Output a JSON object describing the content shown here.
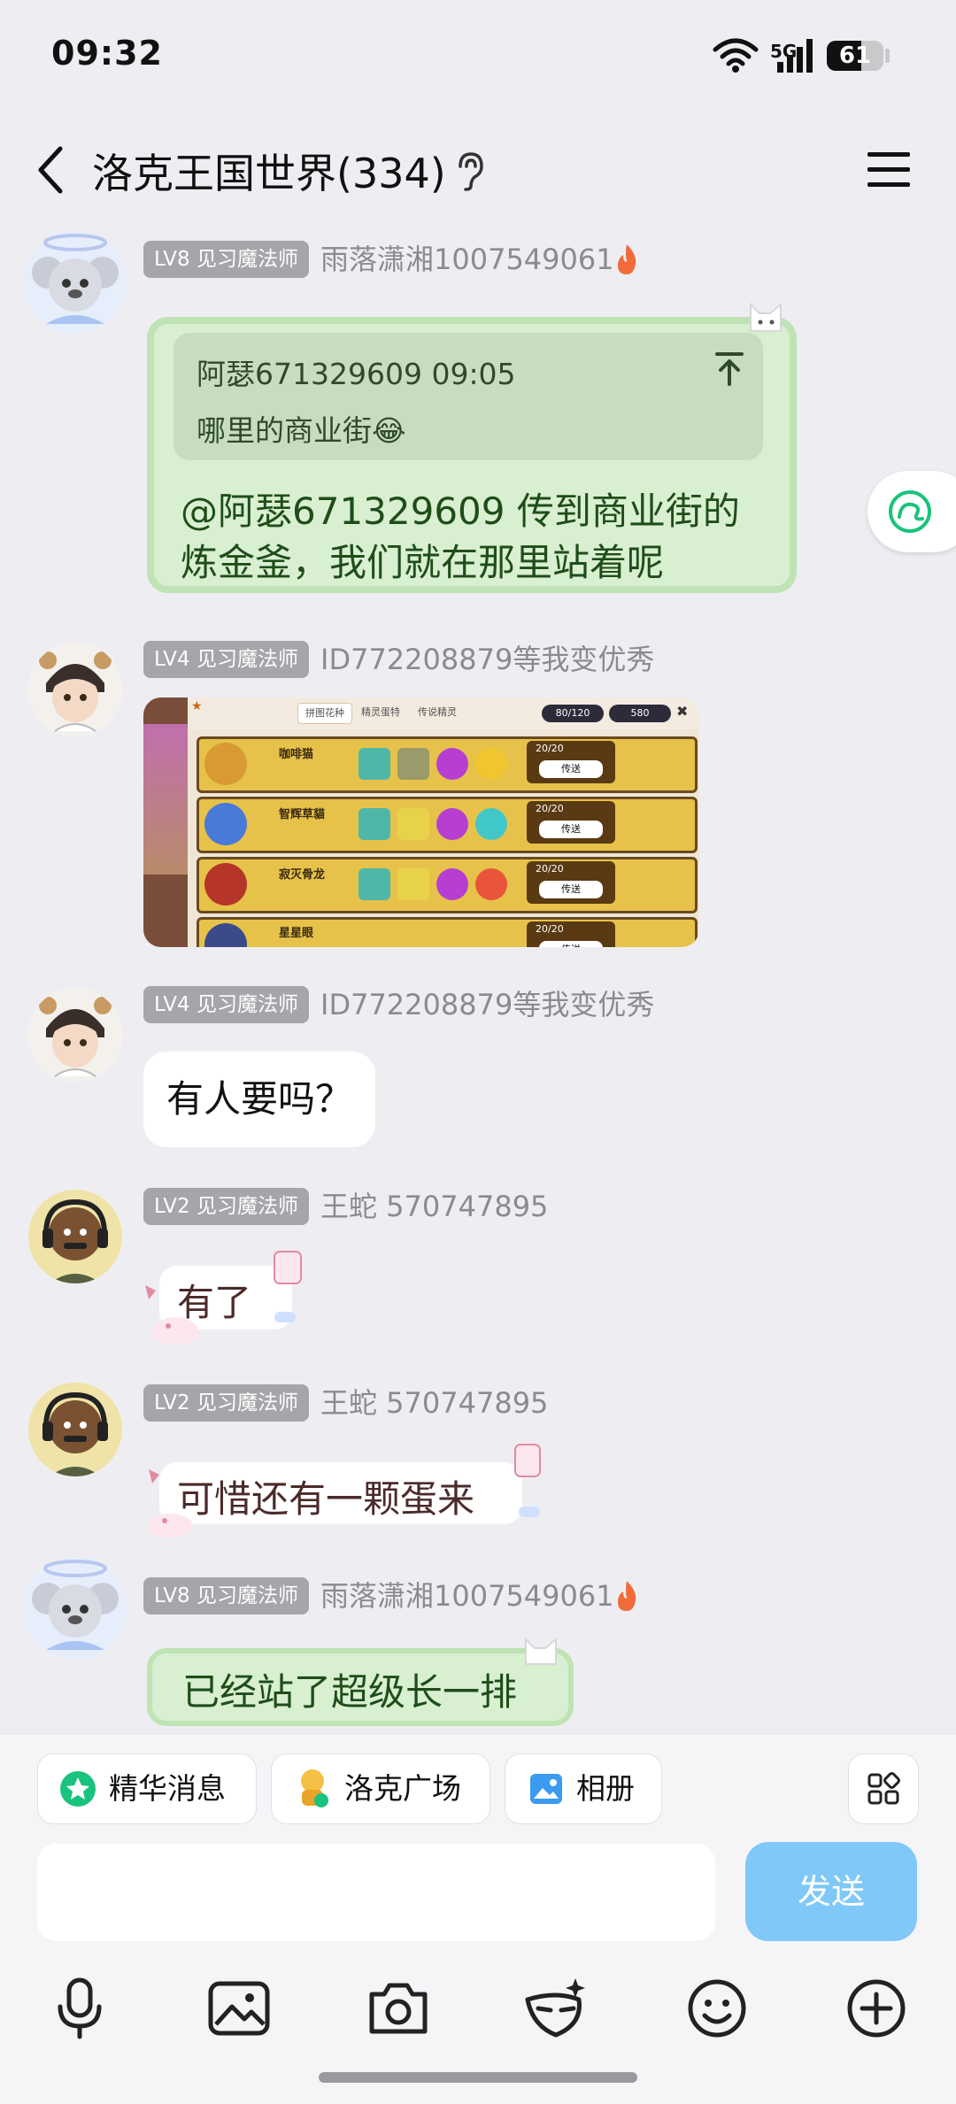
{
  "status_bar": {
    "time": "09:32",
    "network": "5G",
    "battery": "61",
    "battery_level": 0.61
  },
  "header": {
    "title": "洛克王国世界(334)"
  },
  "messages": [
    {
      "badge": "LV8 见习魔法师",
      "sender": "雨落潇湘1007549061",
      "quote": {
        "author": "阿瑟671329609 09:05",
        "text": "哪里的商业街😂"
      },
      "text_line1": "@阿瑟671329609 传到商业街的",
      "text_line2": "炼金釜，我们就在那里站着呢"
    },
    {
      "badge": "LV4 见习魔法师",
      "sender": "ID772208879等我变优秀"
    },
    {
      "badge": "LV4 见习魔法师",
      "sender": "ID772208879等我变优秀",
      "text": "有人要吗？"
    },
    {
      "badge": "LV2 见习魔法师",
      "sender": "王蛇 570747895",
      "text": "有了"
    },
    {
      "badge": "LV2 见习魔法师",
      "sender": "王蛇 570747895",
      "text": "可惜还有一颗蛋来"
    },
    {
      "badge": "LV8 见习魔法师",
      "sender": "雨落潇湘1007549061",
      "text": "已经站了超级长一排"
    }
  ],
  "game_screenshot": {
    "tabs": [
      "拼图花种",
      "精灵蛋特",
      "传说精灵"
    ],
    "counter1": "80/120",
    "counter2": "580",
    "rows": [
      {
        "name": "咖啡猫",
        "count": "20/20",
        "btn": "传送"
      },
      {
        "name": "智辉草貓",
        "count": "20/20",
        "btn": "传送"
      },
      {
        "name": "寂灭骨龙",
        "count": "20/20",
        "btn": "传送"
      },
      {
        "name": "星星眼",
        "count": "20/20",
        "btn": "传送"
      }
    ]
  },
  "toolbar": {
    "chips": [
      {
        "label": "精华消息",
        "icon": "star-badge-icon"
      },
      {
        "label": "洛克广场",
        "icon": "roco-mascot-icon"
      },
      {
        "label": "相册",
        "icon": "photo-icon"
      }
    ],
    "send_label": "发送",
    "input_placeholder": ""
  },
  "colors": {
    "accent_blue": "#7fc8f7",
    "badge_gray": "#a5a5aa",
    "green_bubble": "#d9efd1",
    "essence_green": "#19c37d"
  }
}
